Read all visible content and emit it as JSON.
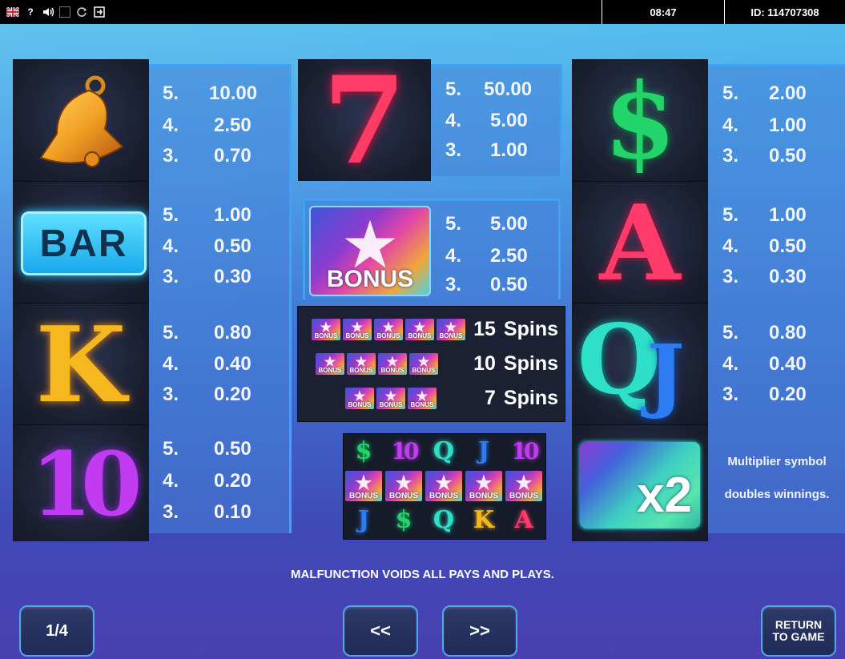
{
  "topbar": {
    "time": "08:47",
    "id": "ID: 114707308",
    "icons": [
      "uk-flag-icon",
      "help-icon",
      "sound-icon",
      "stop-icon",
      "autoplay-icon",
      "exit-icon"
    ],
    "help_glyph": "?"
  },
  "left_column": [
    {
      "symbol": "bell",
      "pays": [
        {
          "n": "5.",
          "v": "10.00"
        },
        {
          "n": "4.",
          "v": "2.50"
        },
        {
          "n": "3.",
          "v": "0.70"
        }
      ]
    },
    {
      "symbol": "BAR",
      "pays": [
        {
          "n": "5.",
          "v": "1.00"
        },
        {
          "n": "4.",
          "v": "0.50"
        },
        {
          "n": "3.",
          "v": "0.30"
        }
      ]
    },
    {
      "symbol": "K",
      "pays": [
        {
          "n": "5.",
          "v": "0.80"
        },
        {
          "n": "4.",
          "v": "0.40"
        },
        {
          "n": "3.",
          "v": "0.20"
        }
      ]
    },
    {
      "symbol": "10",
      "pays": [
        {
          "n": "5.",
          "v": "0.50"
        },
        {
          "n": "4.",
          "v": "0.20"
        },
        {
          "n": "3.",
          "v": "0.10"
        }
      ]
    }
  ],
  "middle_column": {
    "seven": {
      "symbol": "7",
      "pays": [
        {
          "n": "5.",
          "v": "50.00"
        },
        {
          "n": "4.",
          "v": "5.00"
        },
        {
          "n": "3.",
          "v": "1.00"
        }
      ]
    },
    "bonus": {
      "label": "BONUS",
      "pays": [
        {
          "n": "5.",
          "v": "5.00"
        },
        {
          "n": "4.",
          "v": "2.50"
        },
        {
          "n": "3.",
          "v": "0.50"
        }
      ]
    },
    "free_spins": [
      {
        "count": "15",
        "label": "Spins",
        "bonus_count": 5
      },
      {
        "count": "10",
        "label": "Spins",
        "bonus_count": 4
      },
      {
        "count": "7",
        "label": "Spins",
        "bonus_count": 3
      }
    ],
    "example_grid": [
      [
        "$",
        "10",
        "Q",
        "J",
        "10"
      ],
      [
        "BONUS",
        "BONUS",
        "BONUS",
        "BONUS",
        "BONUS"
      ],
      [
        "J",
        "$",
        "Q",
        "K",
        "A"
      ]
    ]
  },
  "right_column": [
    {
      "symbol": "$",
      "pays": [
        {
          "n": "5.",
          "v": "2.00"
        },
        {
          "n": "4.",
          "v": "1.00"
        },
        {
          "n": "3.",
          "v": "0.50"
        }
      ]
    },
    {
      "symbol": "A",
      "pays": [
        {
          "n": "5.",
          "v": "1.00"
        },
        {
          "n": "4.",
          "v": "0.50"
        },
        {
          "n": "3.",
          "v": "0.30"
        }
      ]
    },
    {
      "symbol": "QJ",
      "pays": [
        {
          "n": "5.",
          "v": "0.80"
        },
        {
          "n": "4.",
          "v": "0.40"
        },
        {
          "n": "3.",
          "v": "0.20"
        }
      ]
    }
  ],
  "multiplier": {
    "symbol": "x2",
    "line1": "Multiplier symbol",
    "line2": "doubles winnings."
  },
  "disclaimer": "MALFUNCTION VOIDS ALL PAYS AND PLAYS.",
  "nav": {
    "page": "1/4",
    "prev": "<<",
    "next": ">>",
    "return_line1": "RETURN",
    "return_line2": "TO GAME"
  },
  "colors": {
    "bell": "#f2a227",
    "bar": "#28c7ff",
    "k": "#f5b81e",
    "ten": "#c13cf0",
    "seven": "#ff3c66",
    "dollar": "#22d46a",
    "a": "#ff3b6b",
    "q": "#2fe0c8",
    "j": "#2e7cf2"
  }
}
